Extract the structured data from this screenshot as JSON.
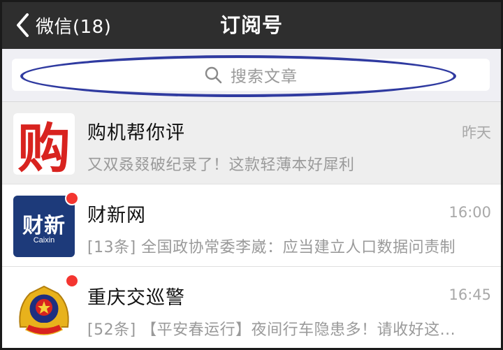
{
  "navbar": {
    "back_label": "微信(18)",
    "title": "订阅号"
  },
  "search": {
    "placeholder": "搜索文章"
  },
  "accounts": [
    {
      "name": "购机帮你评",
      "time": "昨天",
      "preview": "又双叒叕破纪录了！这款轻薄本好犀利",
      "avatar_text": "购",
      "unread": false
    },
    {
      "name": "财新网",
      "time": "16:00",
      "preview": "[13条] 全国政协常委李崴：应当建立人口数据问责制",
      "avatar_text": "财新",
      "avatar_sub": "Caixin",
      "unread": true
    },
    {
      "name": "重庆交巡警",
      "time": "16:45",
      "preview": "[52条] 【平安春运行】夜间行车隐患多！请收好这...",
      "unread": true
    }
  ],
  "colors": {
    "navbar_bg": "#2e2e2e",
    "accent_red": "#f43530",
    "annotation_blue": "#2f3aa0",
    "caixin_blue": "#1d3a7a"
  }
}
